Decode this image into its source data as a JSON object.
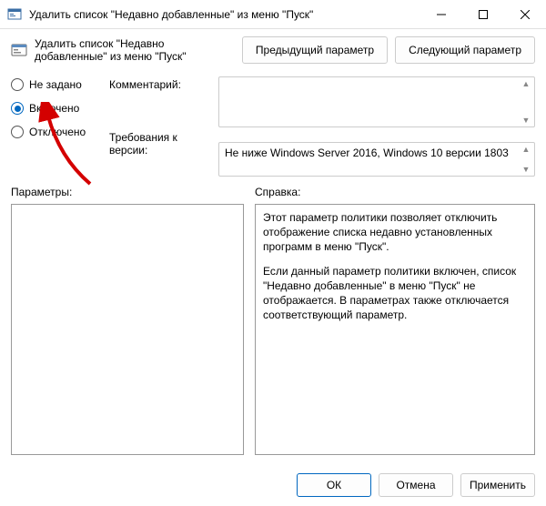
{
  "window": {
    "title": "Удалить список \"Недавно добавленные\" из меню \"Пуск\""
  },
  "subheader": {
    "title": "Удалить список \"Недавно добавленные\" из меню \"Пуск\""
  },
  "nav": {
    "prev": "Предыдущий параметр",
    "next": "Следующий параметр"
  },
  "radios": {
    "not_configured": "Не задано",
    "enabled": "Включено",
    "disabled": "Отключено",
    "selected": "enabled"
  },
  "meta": {
    "comment_label": "Комментарий:",
    "requirements_label": "Требования к версии:",
    "requirements_text": "Не ниже Windows Server 2016, Windows 10 версии 1803"
  },
  "sections": {
    "params_label": "Параметры:",
    "help_label": "Справка:"
  },
  "help": {
    "p1": "Этот параметр политики позволяет отключить отображение списка недавно установленных программ в меню \"Пуск\".",
    "p2": "Если данный параметр политики включен, список \"Недавно добавленные\" в меню \"Пуск\" не отображается.  В параметрах также отключается соответствующий параметр."
  },
  "footer": {
    "ok": "ОК",
    "cancel": "Отмена",
    "apply": "Применить"
  }
}
